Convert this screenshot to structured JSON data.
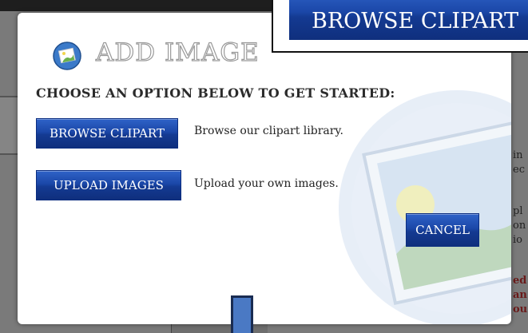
{
  "background": {
    "text_lines": [
      "in",
      "ec",
      "pl",
      "on",
      "io"
    ],
    "red_text_lines": [
      "ed",
      "an",
      "ou"
    ]
  },
  "modal": {
    "title": "ADD IMAGE",
    "subtitle": "CHOOSE AN OPTION BELOW TO GET STARTED:",
    "options": [
      {
        "button_label": "BROWSE CLIPART",
        "description": "Browse our clipart library."
      },
      {
        "button_label": "UPLOAD IMAGES",
        "description": "Upload your own images."
      }
    ],
    "cancel_label": "CANCEL"
  },
  "callout": {
    "label": "BROWSE CLIPART"
  },
  "colors": {
    "button_blue": "#1b47a8",
    "title_outline": "#9a9a9a"
  }
}
